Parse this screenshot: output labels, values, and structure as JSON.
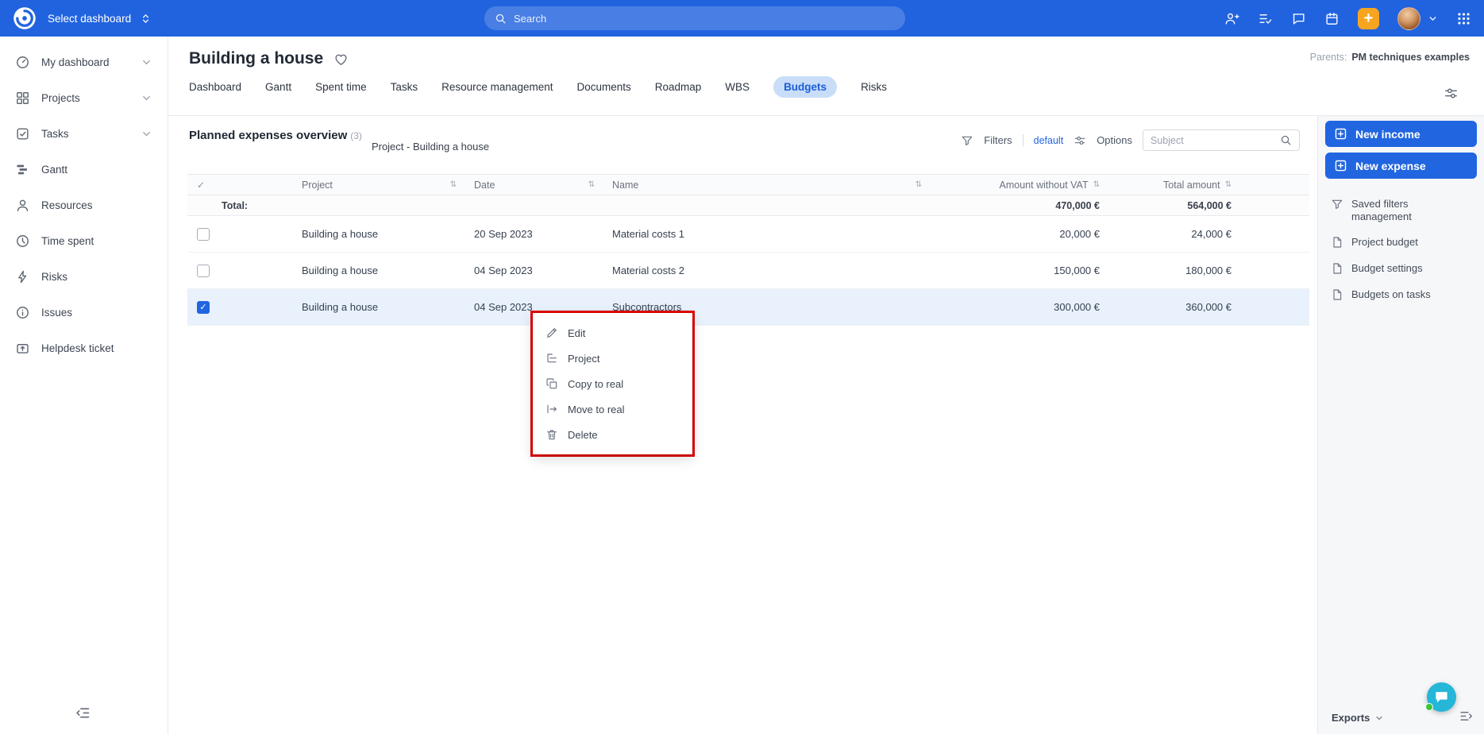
{
  "topbar": {
    "select_dashboard": "Select dashboard",
    "search_placeholder": "Search"
  },
  "sidebar": {
    "items": [
      {
        "label": "My dashboard"
      },
      {
        "label": "Projects"
      },
      {
        "label": "Tasks"
      },
      {
        "label": "Gantt"
      },
      {
        "label": "Resources"
      },
      {
        "label": "Time spent"
      },
      {
        "label": "Risks"
      },
      {
        "label": "Issues"
      },
      {
        "label": "Helpdesk ticket"
      }
    ]
  },
  "header": {
    "title": "Building a house",
    "parents_label": "Parents:",
    "parents_value": "PM techniques examples",
    "tabs": [
      {
        "label": "Dashboard"
      },
      {
        "label": "Gantt"
      },
      {
        "label": "Spent time"
      },
      {
        "label": "Tasks"
      },
      {
        "label": "Resource management"
      },
      {
        "label": "Documents"
      },
      {
        "label": "Roadmap"
      },
      {
        "label": "WBS"
      },
      {
        "label": "Budgets",
        "active": true
      },
      {
        "label": "Risks"
      }
    ]
  },
  "toolbar": {
    "section_title": "Planned expenses overview",
    "section_count": "(3)",
    "subtitle": "Project - Building a house",
    "filters_label": "Filters",
    "filters_value": "default",
    "options_label": "Options",
    "search_placeholder": "Subject"
  },
  "table": {
    "header": {
      "project": "Project",
      "date": "Date",
      "name": "Name",
      "amount_without_vat": "Amount without VAT",
      "total_amount": "Total amount"
    },
    "total": {
      "label": "Total:",
      "amount_without_vat": "470,000 €",
      "total_amount": "564,000 €"
    },
    "rows": [
      {
        "project": "Building a house",
        "date": "20 Sep 2023",
        "name": "Material costs 1",
        "amount_without_vat": "20,000 €",
        "total_amount": "24,000 €",
        "selected": false
      },
      {
        "project": "Building a house",
        "date": "04 Sep 2023",
        "name": "Material costs 2",
        "amount_without_vat": "150,000 €",
        "total_amount": "180,000 €",
        "selected": false
      },
      {
        "project": "Building a house",
        "date": "04 Sep 2023",
        "name": "Subcontractors",
        "amount_without_vat": "300,000 €",
        "total_amount": "360,000 €",
        "selected": true
      }
    ]
  },
  "context_menu": {
    "items": [
      {
        "label": "Edit"
      },
      {
        "label": "Project"
      },
      {
        "label": "Copy to real"
      },
      {
        "label": "Move to real"
      },
      {
        "label": "Delete"
      }
    ]
  },
  "right_panel": {
    "new_income": "New income",
    "new_expense": "New expense",
    "links": [
      {
        "label": "Saved filters management"
      },
      {
        "label": "Project budget"
      },
      {
        "label": "Budget settings"
      },
      {
        "label": "Budgets on tasks"
      }
    ],
    "exports_label": "Exports"
  },
  "colors": {
    "topbar_blue": "#2163df",
    "accent_blue": "#2166e0",
    "active_tab_bg": "#c9ddf8",
    "selected_row_bg": "#e8f1fc",
    "annotation_red": "#e00000",
    "quick_add_orange": "#f7a521",
    "chat_teal": "#25b6d8",
    "online_green": "#3fc33c"
  }
}
